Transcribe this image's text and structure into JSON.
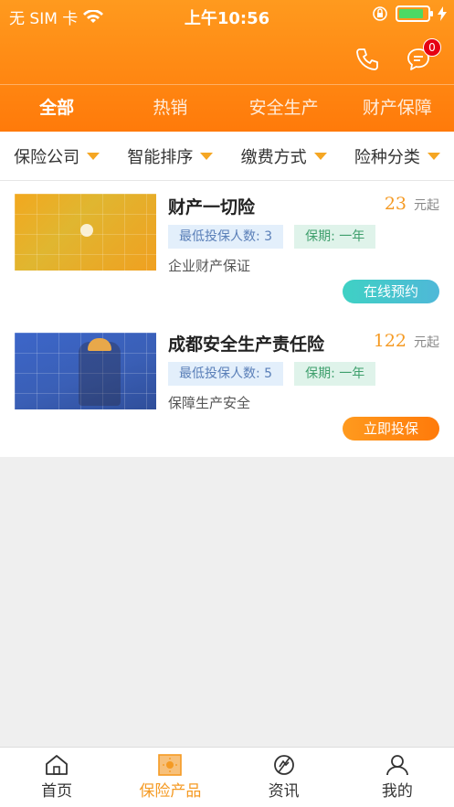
{
  "status_bar": {
    "carrier": "无 SIM 卡",
    "time": "上午10:56",
    "battery_level": 0.85,
    "icons": [
      "wifi-icon",
      "orientation-lock-icon",
      "battery-icon",
      "charging-icon"
    ]
  },
  "header": {
    "badge_count": "0",
    "icons": [
      "phone-icon",
      "message-icon"
    ],
    "background_color": "#ff8a12"
  },
  "tabs": [
    {
      "label": "全部",
      "active": true
    },
    {
      "label": "热销",
      "active": false
    },
    {
      "label": "安全生产",
      "active": false
    },
    {
      "label": "财产保障",
      "active": false
    }
  ],
  "filters": [
    {
      "label": "保险公司"
    },
    {
      "label": "智能排序"
    },
    {
      "label": "缴费方式"
    },
    {
      "label": "险种分类"
    }
  ],
  "products": [
    {
      "title": "财产一切险",
      "price": "23",
      "price_unit": "元起",
      "min_insured_label": "最低投保人数:",
      "min_insured": "3",
      "term_label": "保期:",
      "term": "一年",
      "description": "企业财产保证",
      "button_label": "在线预约"
    },
    {
      "title": "成都安全生产责任险",
      "price": "122",
      "price_unit": "元起",
      "min_insured_label": "最低投保人数:",
      "min_insured": "5",
      "term_label": "保期:",
      "term": "一年",
      "description": "保障生产安全",
      "button_label": "立即投保"
    }
  ],
  "bottom_nav": [
    {
      "label": "首页",
      "icon": "home-icon",
      "active": false
    },
    {
      "label": "保险产品",
      "icon": "product-icon",
      "active": true
    },
    {
      "label": "资讯",
      "icon": "news-icon",
      "active": false
    },
    {
      "label": "我的",
      "icon": "user-icon",
      "active": false
    }
  ],
  "colors": {
    "accent": "#f59a23",
    "badge": "#e60012"
  }
}
